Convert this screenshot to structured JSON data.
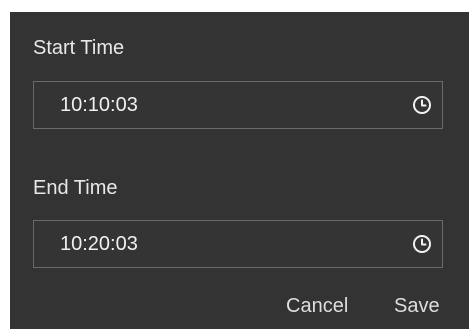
{
  "start": {
    "label": "Start Time",
    "value": "10:10:03",
    "icon": "clock-icon"
  },
  "end": {
    "label": "End Time",
    "value": "10:20:03",
    "icon": "clock-icon"
  },
  "actions": {
    "cancel_label": "Cancel",
    "save_label": "Save"
  },
  "colors": {
    "background": "#333333",
    "text": "#e8e8e8",
    "field_border": "#6a6a6a"
  }
}
